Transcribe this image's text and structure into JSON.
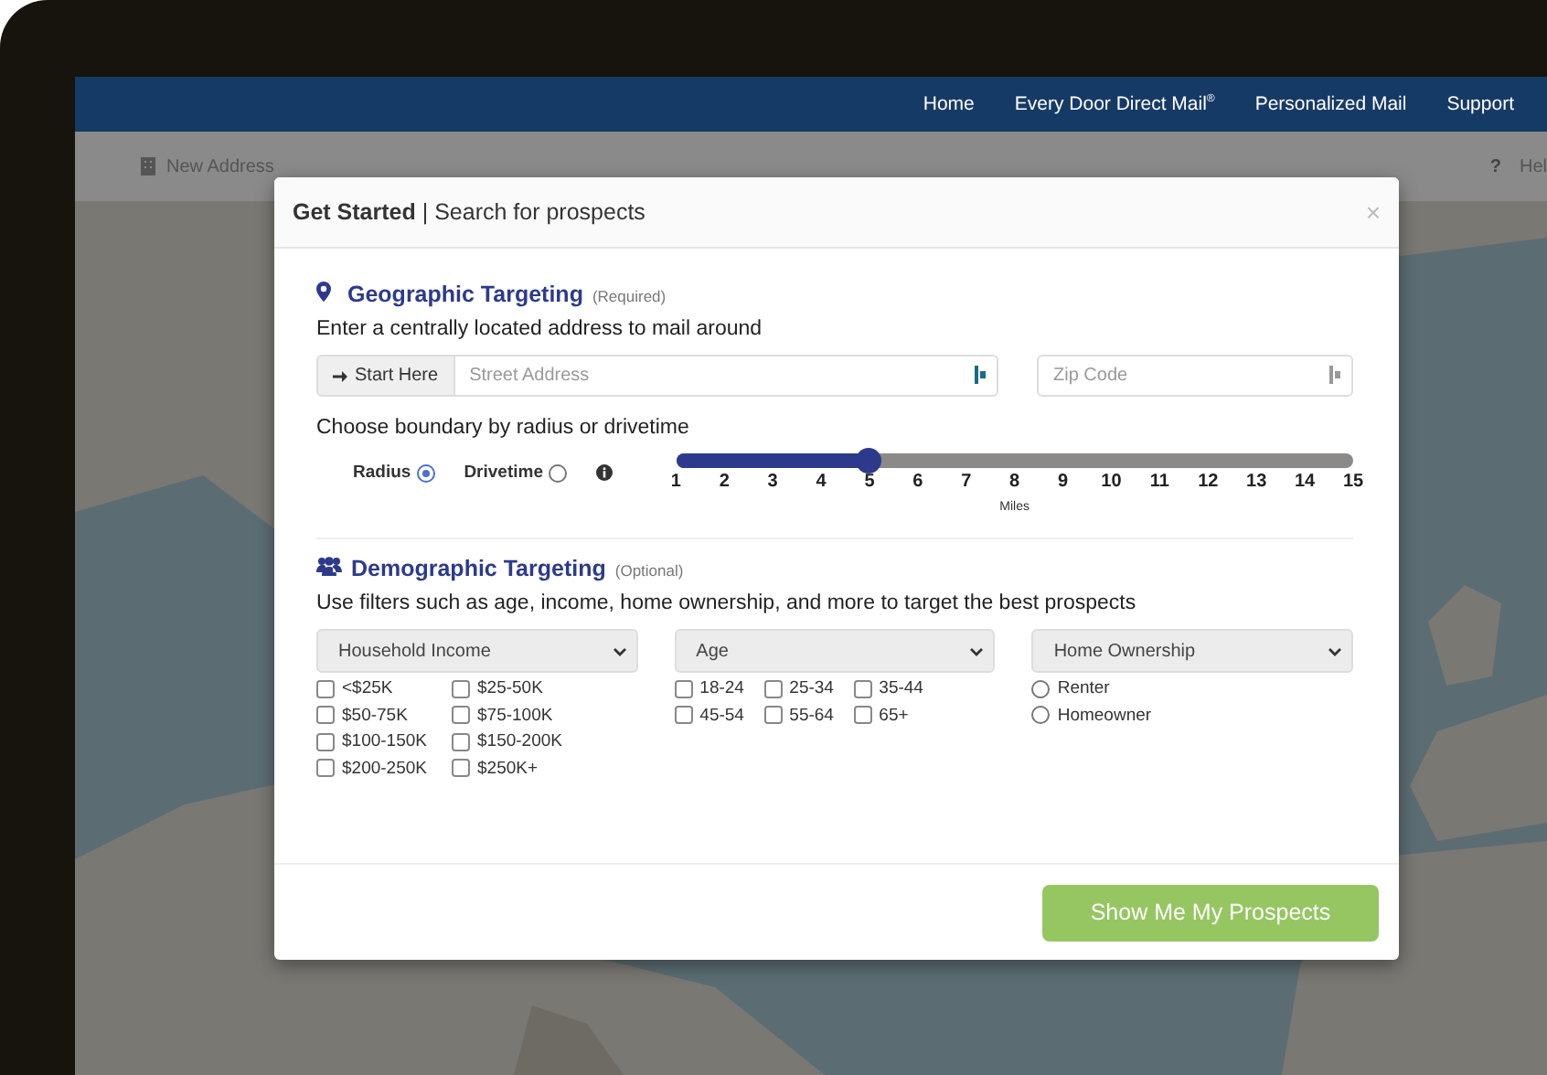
{
  "nav": {
    "links": [
      {
        "label": "Home"
      },
      {
        "label": "Every Door Direct Mail$^{®}$"
      },
      {
        "label": "Personalized Mail"
      },
      {
        "label": "Support"
      }
    ]
  },
  "toolbar": {
    "new_address": "New Address",
    "help_icon": "?",
    "help": "Hel"
  },
  "modal": {
    "title": "**Get Started** | Search for prospects",
    "close": "×",
    "geographic": {
      "heading": "Geographic Targeting",
      "note": "(Required)",
      "prompt": "Enter a centrally located address to mail around",
      "start_button": "Start Here",
      "street": {
        "placeholder": "Street Address"
      },
      "zip": {
        "placeholder": "Zip Code"
      },
      "boundary_prompt": "Choose boundary by radius or drivetime",
      "modes": [
        {
          "label": "Radius",
          "selected": true
        },
        {
          "label": "Drivetime",
          "selected": false
        }
      ],
      "slider": {
        "level": 0.2857,
        "ticks": [
          "1",
          "2",
          "3",
          "4",
          "5",
          "6",
          "7",
          "8",
          "9",
          "10",
          "11",
          "12",
          "13",
          "14",
          "15"
        ],
        "unit": "Miles"
      }
    },
    "demographic": {
      "heading": "Demographic Targeting",
      "note": "(Optional)",
      "prompt": "Use filters such as age, income, home ownership, and more to target the best prospects",
      "filters": [
        {
          "select": "Household Income",
          "kind": "checkbox",
          "rows": [
            [
              {
                "label": "<$25K",
                "checked": false
              },
              {
                "label": "$25-50K",
                "checked": false
              }
            ],
            [
              {
                "label": "$50-75K",
                "checked": false
              },
              {
                "label": "$75-100K",
                "checked": false
              }
            ],
            [
              {
                "label": "$100-150K",
                "checked": false
              },
              {
                "label": "$150-200K",
                "checked": false
              }
            ],
            [
              {
                "label": "$200-250K",
                "checked": false
              },
              {
                "label": "$250K+",
                "checked": false
              }
            ]
          ]
        },
        {
          "select": "Age",
          "kind": "checkbox",
          "rows": [
            [
              {
                "label": "18-24",
                "checked": false
              },
              {
                "label": "25-34",
                "checked": false
              },
              {
                "label": "35-44",
                "checked": false
              }
            ],
            [
              {
                "label": "45-54",
                "checked": false
              },
              {
                "label": "55-64",
                "checked": false
              },
              {
                "label": "65+",
                "checked": false
              }
            ]
          ]
        },
        {
          "select": "Home Ownership",
          "kind": "radio",
          "rows": [
            [
              {
                "label": "Renter",
                "selected": false
              }
            ],
            [
              {
                "label": "Homeowner",
                "selected": false
              }
            ]
          ]
        }
      ]
    },
    "submit": "Show Me My Prospects"
  }
}
